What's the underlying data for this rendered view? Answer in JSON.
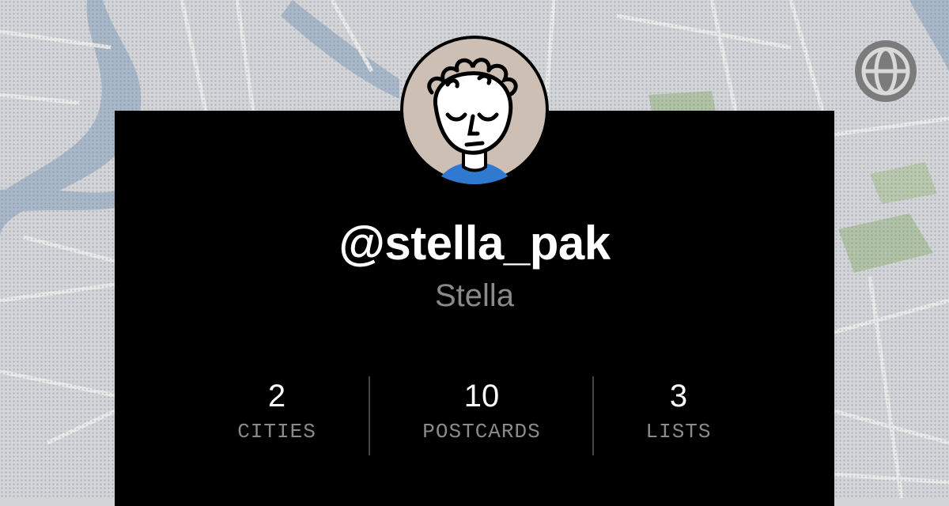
{
  "profile": {
    "handle": "@stella_pak",
    "display_name": "Stella",
    "avatar_icon": "sleepy-face-avatar"
  },
  "stats": [
    {
      "value": "2",
      "label": "CITIES"
    },
    {
      "value": "10",
      "label": "POSTCARDS"
    },
    {
      "value": "3",
      "label": "LISTS"
    }
  ],
  "icons": {
    "globe": "globe-icon"
  },
  "colors": {
    "card": "#000000",
    "handle": "#ffffff",
    "muted": "#8a8a8a",
    "avatar_bg": "#cdbfb3",
    "shirt": "#2f7ad0",
    "map_water": "#a7b7c8",
    "map_park": "#aec1a0"
  }
}
